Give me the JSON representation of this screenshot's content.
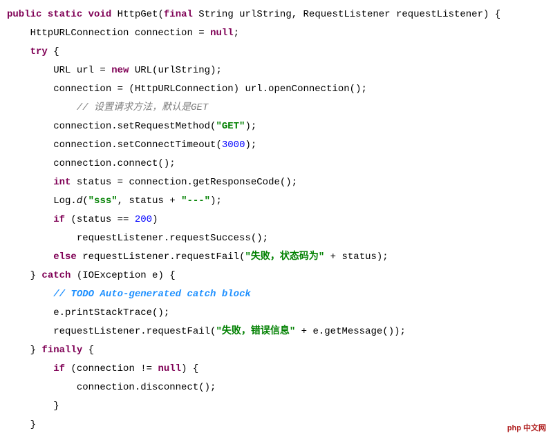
{
  "code": {
    "l1": {
      "kw1": "public",
      "kw2": "static",
      "kw3": "void",
      "fn": " HttpGet(",
      "kw4": "final",
      "rest": " String urlString, RequestListener requestListener) {"
    },
    "l2": {
      "t": "    HttpURLConnection connection = ",
      "kw": "null",
      "end": ";"
    },
    "l3": {
      "ind": "    ",
      "kw": "try",
      "rest": " {"
    },
    "l4": {
      "ind": "        URL url = ",
      "kw": "new",
      "rest": " URL(urlString);"
    },
    "l5": "        connection = (HttpURLConnection) url.openConnection();",
    "l6": {
      "ind": "            ",
      "cmt": "// 设置请求方法，默认是GET"
    },
    "l7": {
      "a": "        connection.setRequestMethod(",
      "s": "\"GET\"",
      "b": ");"
    },
    "l8": {
      "a": "        connection.setConnectTimeout(",
      "n": "3000",
      "b": ");"
    },
    "l9": "        connection.connect();",
    "l10": {
      "ind": "        ",
      "kw": "int",
      "rest": " status = connection.getResponseCode();"
    },
    "l11": {
      "a": "        Log.",
      "m": "d",
      "b": "(",
      "s1": "\"sss\"",
      "c": ", status + ",
      "s2": "\"---\"",
      "d": ");"
    },
    "l12": {
      "ind": "        ",
      "kw": "if",
      "a": " (status == ",
      "n": "200",
      "b": ")"
    },
    "l13": "            requestListener.requestSuccess();",
    "l14": {
      "ind": "        ",
      "kw": "else",
      "a": " requestListener.requestFail(",
      "s": "\"失败，状态码为\"",
      "b": " + status);"
    },
    "l15": {
      "ind": "    } ",
      "kw": "catch",
      "rest": " (IOException e) {"
    },
    "l16": {
      "ind": "        ",
      "cmt": "// TODO Auto-generated catch block"
    },
    "l17": "        e.printStackTrace();",
    "l18": {
      "a": "        requestListener.requestFail(",
      "s": "\"失败，错误信息\"",
      "b": " + e.getMessage());"
    },
    "l19": {
      "ind": "    } ",
      "kw": "finally",
      "rest": " {"
    },
    "l20": {
      "ind": "        ",
      "kw": "if",
      "a": " (connection != ",
      "kw2": "null",
      "b": ") {"
    },
    "l21": "            connection.disconnect();",
    "l22": "        }",
    "l23": "    }"
  },
  "watermark": "php 中文网"
}
